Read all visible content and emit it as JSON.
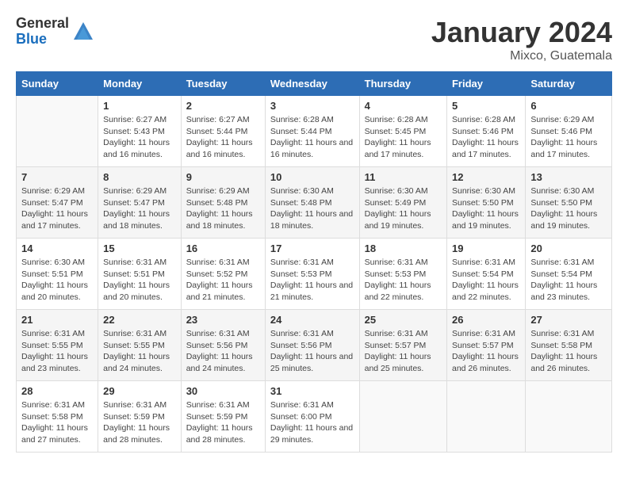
{
  "logo": {
    "general": "General",
    "blue": "Blue"
  },
  "title": "January 2024",
  "subtitle": "Mixco, Guatemala",
  "weekdays": [
    "Sunday",
    "Monday",
    "Tuesday",
    "Wednesday",
    "Thursday",
    "Friday",
    "Saturday"
  ],
  "weeks": [
    [
      {
        "day": "",
        "sunrise": "",
        "sunset": "",
        "daylight": ""
      },
      {
        "day": "1",
        "sunrise": "Sunrise: 6:27 AM",
        "sunset": "Sunset: 5:43 PM",
        "daylight": "Daylight: 11 hours and 16 minutes."
      },
      {
        "day": "2",
        "sunrise": "Sunrise: 6:27 AM",
        "sunset": "Sunset: 5:44 PM",
        "daylight": "Daylight: 11 hours and 16 minutes."
      },
      {
        "day": "3",
        "sunrise": "Sunrise: 6:28 AM",
        "sunset": "Sunset: 5:44 PM",
        "daylight": "Daylight: 11 hours and 16 minutes."
      },
      {
        "day": "4",
        "sunrise": "Sunrise: 6:28 AM",
        "sunset": "Sunset: 5:45 PM",
        "daylight": "Daylight: 11 hours and 17 minutes."
      },
      {
        "day": "5",
        "sunrise": "Sunrise: 6:28 AM",
        "sunset": "Sunset: 5:46 PM",
        "daylight": "Daylight: 11 hours and 17 minutes."
      },
      {
        "day": "6",
        "sunrise": "Sunrise: 6:29 AM",
        "sunset": "Sunset: 5:46 PM",
        "daylight": "Daylight: 11 hours and 17 minutes."
      }
    ],
    [
      {
        "day": "7",
        "sunrise": "Sunrise: 6:29 AM",
        "sunset": "Sunset: 5:47 PM",
        "daylight": "Daylight: 11 hours and 17 minutes."
      },
      {
        "day": "8",
        "sunrise": "Sunrise: 6:29 AM",
        "sunset": "Sunset: 5:47 PM",
        "daylight": "Daylight: 11 hours and 18 minutes."
      },
      {
        "day": "9",
        "sunrise": "Sunrise: 6:29 AM",
        "sunset": "Sunset: 5:48 PM",
        "daylight": "Daylight: 11 hours and 18 minutes."
      },
      {
        "day": "10",
        "sunrise": "Sunrise: 6:30 AM",
        "sunset": "Sunset: 5:48 PM",
        "daylight": "Daylight: 11 hours and 18 minutes."
      },
      {
        "day": "11",
        "sunrise": "Sunrise: 6:30 AM",
        "sunset": "Sunset: 5:49 PM",
        "daylight": "Daylight: 11 hours and 19 minutes."
      },
      {
        "day": "12",
        "sunrise": "Sunrise: 6:30 AM",
        "sunset": "Sunset: 5:50 PM",
        "daylight": "Daylight: 11 hours and 19 minutes."
      },
      {
        "day": "13",
        "sunrise": "Sunrise: 6:30 AM",
        "sunset": "Sunset: 5:50 PM",
        "daylight": "Daylight: 11 hours and 19 minutes."
      }
    ],
    [
      {
        "day": "14",
        "sunrise": "Sunrise: 6:30 AM",
        "sunset": "Sunset: 5:51 PM",
        "daylight": "Daylight: 11 hours and 20 minutes."
      },
      {
        "day": "15",
        "sunrise": "Sunrise: 6:31 AM",
        "sunset": "Sunset: 5:51 PM",
        "daylight": "Daylight: 11 hours and 20 minutes."
      },
      {
        "day": "16",
        "sunrise": "Sunrise: 6:31 AM",
        "sunset": "Sunset: 5:52 PM",
        "daylight": "Daylight: 11 hours and 21 minutes."
      },
      {
        "day": "17",
        "sunrise": "Sunrise: 6:31 AM",
        "sunset": "Sunset: 5:53 PM",
        "daylight": "Daylight: 11 hours and 21 minutes."
      },
      {
        "day": "18",
        "sunrise": "Sunrise: 6:31 AM",
        "sunset": "Sunset: 5:53 PM",
        "daylight": "Daylight: 11 hours and 22 minutes."
      },
      {
        "day": "19",
        "sunrise": "Sunrise: 6:31 AM",
        "sunset": "Sunset: 5:54 PM",
        "daylight": "Daylight: 11 hours and 22 minutes."
      },
      {
        "day": "20",
        "sunrise": "Sunrise: 6:31 AM",
        "sunset": "Sunset: 5:54 PM",
        "daylight": "Daylight: 11 hours and 23 minutes."
      }
    ],
    [
      {
        "day": "21",
        "sunrise": "Sunrise: 6:31 AM",
        "sunset": "Sunset: 5:55 PM",
        "daylight": "Daylight: 11 hours and 23 minutes."
      },
      {
        "day": "22",
        "sunrise": "Sunrise: 6:31 AM",
        "sunset": "Sunset: 5:55 PM",
        "daylight": "Daylight: 11 hours and 24 minutes."
      },
      {
        "day": "23",
        "sunrise": "Sunrise: 6:31 AM",
        "sunset": "Sunset: 5:56 PM",
        "daylight": "Daylight: 11 hours and 24 minutes."
      },
      {
        "day": "24",
        "sunrise": "Sunrise: 6:31 AM",
        "sunset": "Sunset: 5:56 PM",
        "daylight": "Daylight: 11 hours and 25 minutes."
      },
      {
        "day": "25",
        "sunrise": "Sunrise: 6:31 AM",
        "sunset": "Sunset: 5:57 PM",
        "daylight": "Daylight: 11 hours and 25 minutes."
      },
      {
        "day": "26",
        "sunrise": "Sunrise: 6:31 AM",
        "sunset": "Sunset: 5:57 PM",
        "daylight": "Daylight: 11 hours and 26 minutes."
      },
      {
        "day": "27",
        "sunrise": "Sunrise: 6:31 AM",
        "sunset": "Sunset: 5:58 PM",
        "daylight": "Daylight: 11 hours and 26 minutes."
      }
    ],
    [
      {
        "day": "28",
        "sunrise": "Sunrise: 6:31 AM",
        "sunset": "Sunset: 5:58 PM",
        "daylight": "Daylight: 11 hours and 27 minutes."
      },
      {
        "day": "29",
        "sunrise": "Sunrise: 6:31 AM",
        "sunset": "Sunset: 5:59 PM",
        "daylight": "Daylight: 11 hours and 28 minutes."
      },
      {
        "day": "30",
        "sunrise": "Sunrise: 6:31 AM",
        "sunset": "Sunset: 5:59 PM",
        "daylight": "Daylight: 11 hours and 28 minutes."
      },
      {
        "day": "31",
        "sunrise": "Sunrise: 6:31 AM",
        "sunset": "Sunset: 6:00 PM",
        "daylight": "Daylight: 11 hours and 29 minutes."
      },
      {
        "day": "",
        "sunrise": "",
        "sunset": "",
        "daylight": ""
      },
      {
        "day": "",
        "sunrise": "",
        "sunset": "",
        "daylight": ""
      },
      {
        "day": "",
        "sunrise": "",
        "sunset": "",
        "daylight": ""
      }
    ]
  ]
}
